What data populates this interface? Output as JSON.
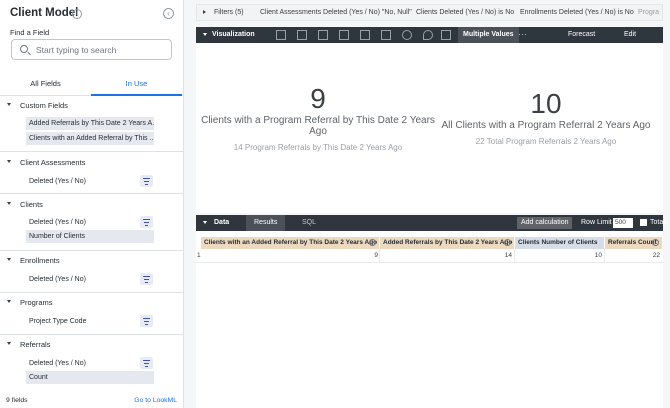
{
  "sidebar": {
    "title": "Client Model",
    "find_label": "Find a Field",
    "search_placeholder": "Start typing to search",
    "tabs": [
      "All Fields",
      "In Use"
    ],
    "sections": [
      {
        "name": "Custom Fields",
        "fields": [
          "Added Referrals by This Date 2 Years A...",
          "Clients with an Added Referral by This ..."
        ]
      },
      {
        "name": "Client Assessments",
        "fields": [
          "Deleted (Yes / No)"
        ]
      },
      {
        "name": "Clients",
        "fields": [
          "Deleted (Yes / No)",
          "Number of Clients"
        ]
      },
      {
        "name": "Enrollments",
        "fields": [
          "Deleted (Yes / No)"
        ]
      },
      {
        "name": "Programs",
        "fields": [
          "Project Type Code"
        ]
      },
      {
        "name": "Referrals",
        "fields": [
          "Deleted (Yes / No)",
          "Count"
        ]
      }
    ],
    "footer_count": "9 fields",
    "footer_link": "Go to LookML"
  },
  "filters": {
    "title": "Filters (5)",
    "items": [
      "Client Assessments Deleted (Yes / No) \"No, Null\"",
      "Clients Deleted (Yes / No) is No",
      "Enrollments Deleted (Yes / No) is No",
      "Progra"
    ]
  },
  "visualization": {
    "label": "Visualization",
    "multiple_values": "Multiple Values",
    "more": "···",
    "forecast": "Forecast",
    "edit": "Edit",
    "tiles": [
      {
        "value": "9",
        "title": "Clients with a Program Referral by This Date 2 Years Ago",
        "comparison": "14 Program Referrals by This Date 2 Years Ago"
      },
      {
        "value": "10",
        "title": "All Clients with a Program Referral 2 Years Ago",
        "comparison": "22 Total Program Referrals 2 Years Ago"
      }
    ]
  },
  "data": {
    "label": "Data",
    "tabs": [
      "Results",
      "SQL"
    ],
    "add_calculation": "Add calculation",
    "row_limit_label": "Row Limit",
    "row_limit_value": "500",
    "totals_label": "Totals",
    "columns": [
      "Clients with an Added Referral by This Date 2 Years Ago",
      "Added Referrals by This Date 2 Years Ago",
      "Clients Number of Clients",
      "Referrals Count"
    ],
    "rows": [
      {
        "num": "1",
        "cells": [
          "9",
          "14",
          "10",
          "22"
        ]
      }
    ]
  }
}
